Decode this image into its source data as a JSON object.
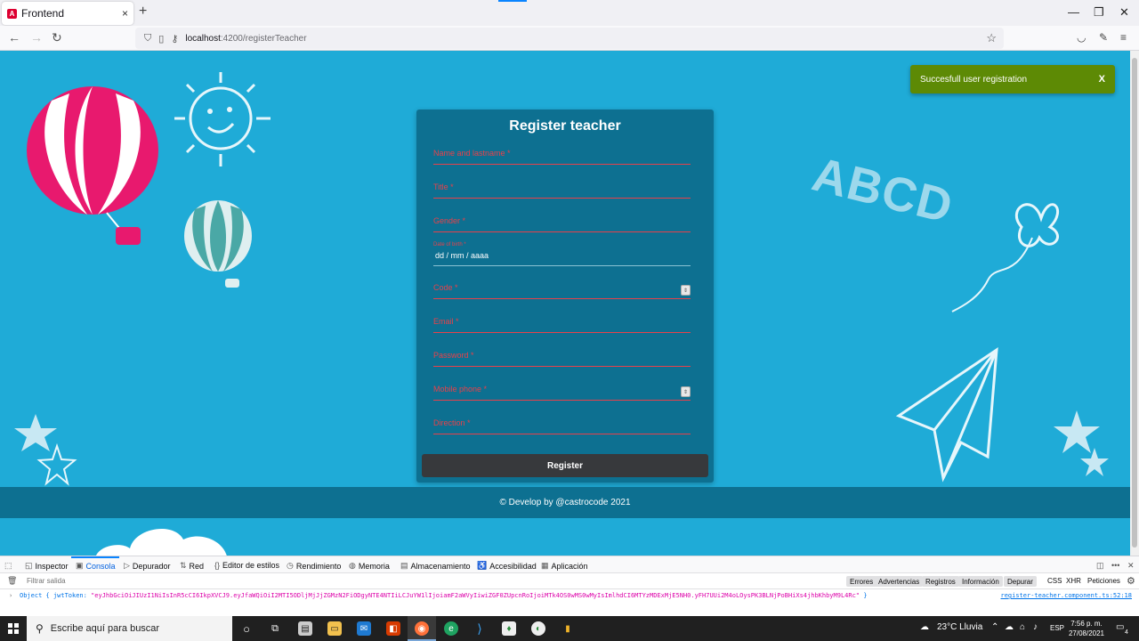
{
  "browser": {
    "tab_title": "Frontend",
    "tab_close": "×",
    "new_tab": "+",
    "url_host": "localhost",
    "url_path": ":4200/registerTeacher"
  },
  "toast": {
    "message": "Succesfull user registration",
    "close": "X"
  },
  "form": {
    "title": "Register teacher",
    "fields": [
      {
        "label": "Name and lastname *"
      },
      {
        "label": "Title *"
      },
      {
        "label": "Gender *"
      },
      {
        "label": "Date of birth *",
        "value": "dd / mm / aaaa"
      },
      {
        "label": "Code *"
      },
      {
        "label": "Email *"
      },
      {
        "label": "Password *"
      },
      {
        "label": "Mobile phone *"
      },
      {
        "label": "Direction *"
      }
    ],
    "submit_label": "Register"
  },
  "footer": {
    "text": "© Develop by @castrocode 2021"
  },
  "doodles": {
    "abcd": "ABCD"
  },
  "devtools": {
    "tabs": [
      "Inspector",
      "Consola",
      "Depurador",
      "Red",
      "Editor de estilos",
      "Rendimiento",
      "Memoria",
      "Almacenamiento",
      "Accesibilidad",
      "Aplicación"
    ],
    "filter_placeholder": "Filtrar salida",
    "filters": [
      "Errores",
      "Advertencias",
      "Registros",
      "Información",
      "Depurar"
    ],
    "filters_plain": [
      "CSS",
      "XHR",
      "Peticiones"
    ],
    "log_prefix": "Object { jwtToken: ",
    "log_token": "\"eyJhbGciOiJIUzI1NiIsInR5cCI6IkpXVCJ9.eyJfaWQiOiI2MTI5ODljMjJjZGMzN2FiODgyNTE4NTIiLCJuYW1lIjoiamF2aWVyIiwiZGF0ZUpcnRoIjoiMTk4OS0wMS0wMyIsImlhdCI6MTYzMDExMjE5NH0.yFH7UUi2M4oLOysPK3BLNjPoBHiXs4jhbKhbyM9L4Rc\"",
    "log_suffix": " }",
    "log_source": "register-teacher.component.ts:52:18"
  },
  "taskbar": {
    "search_placeholder": "Escribe aquí para buscar",
    "weather": "23°C  Lluvia",
    "lang": "ESP",
    "time": "7:56 p. m.",
    "date": "27/08/2021",
    "notif_count": "4"
  }
}
